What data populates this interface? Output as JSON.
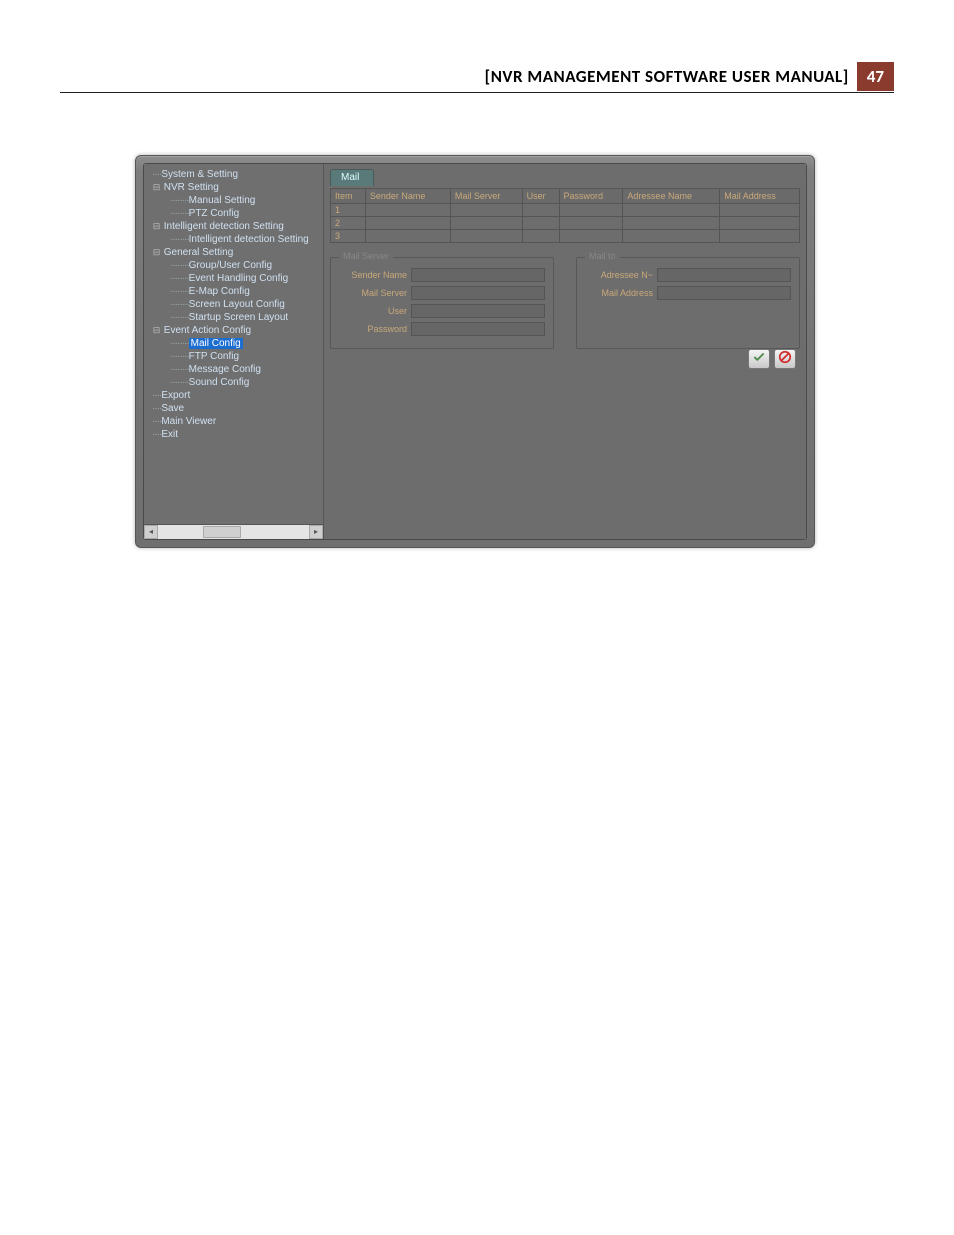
{
  "header": {
    "title": "[NVR MANAGEMENT SOFTWARE USER MANUAL]",
    "page_number": "47"
  },
  "tree": {
    "items": [
      {
        "label": "System & Setting",
        "indent": 0,
        "expand": "",
        "selected": false
      },
      {
        "label": "NVR  Setting",
        "indent": 0,
        "expand": "⊟",
        "selected": false
      },
      {
        "label": "Manual Setting",
        "indent": 1,
        "expand": "",
        "selected": false
      },
      {
        "label": "PTZ Config",
        "indent": 1,
        "expand": "",
        "selected": false
      },
      {
        "label": "Intelligent detection Setting",
        "indent": 0,
        "expand": "⊟",
        "selected": false
      },
      {
        "label": "Intelligent detection Setting",
        "indent": 1,
        "expand": "",
        "selected": false
      },
      {
        "label": "General Setting",
        "indent": 0,
        "expand": "⊟",
        "selected": false
      },
      {
        "label": "Group/User Config",
        "indent": 1,
        "expand": "",
        "selected": false
      },
      {
        "label": "Event Handling Config",
        "indent": 1,
        "expand": "",
        "selected": false
      },
      {
        "label": "E-Map Config",
        "indent": 1,
        "expand": "",
        "selected": false
      },
      {
        "label": "Screen Layout Config",
        "indent": 1,
        "expand": "",
        "selected": false
      },
      {
        "label": "Startup Screen Layout",
        "indent": 1,
        "expand": "",
        "selected": false
      },
      {
        "label": "Event Action Config",
        "indent": 0,
        "expand": "⊟",
        "selected": false
      },
      {
        "label": "Mail Config",
        "indent": 1,
        "expand": "",
        "selected": true
      },
      {
        "label": "FTP Config",
        "indent": 1,
        "expand": "",
        "selected": false
      },
      {
        "label": "Message Config",
        "indent": 1,
        "expand": "",
        "selected": false
      },
      {
        "label": "Sound Config",
        "indent": 1,
        "expand": "",
        "selected": false
      },
      {
        "label": "Export",
        "indent": 0,
        "expand": "",
        "selected": false
      },
      {
        "label": "Save",
        "indent": 0,
        "expand": "",
        "selected": false
      },
      {
        "label": "Main Viewer",
        "indent": 0,
        "expand": "",
        "selected": false
      },
      {
        "label": "Exit",
        "indent": 0,
        "expand": "",
        "selected": false
      }
    ]
  },
  "panel": {
    "tab_label": "Mail",
    "table": {
      "headers": [
        "Item",
        "Sender Name",
        "Mail Server",
        "User",
        "Password",
        "Adressee Name",
        "Mail Address"
      ],
      "rows": [
        {
          "item": "1",
          "sender_name": "",
          "mail_server": "",
          "user": "",
          "password": "",
          "adressee_name": "",
          "mail_address": ""
        },
        {
          "item": "2",
          "sender_name": "",
          "mail_server": "",
          "user": "",
          "password": "",
          "adressee_name": "",
          "mail_address": ""
        },
        {
          "item": "3",
          "sender_name": "",
          "mail_server": "",
          "user": "",
          "password": "",
          "adressee_name": "",
          "mail_address": ""
        }
      ]
    },
    "mail_server": {
      "legend": "Mail Server",
      "fields": {
        "sender_name": {
          "label": "Sender Name",
          "value": ""
        },
        "mail_server": {
          "label": "Mail Server",
          "value": ""
        },
        "user": {
          "label": "User",
          "value": ""
        },
        "password": {
          "label": "Password",
          "value": ""
        }
      }
    },
    "mail_to": {
      "legend": "Mail to",
      "fields": {
        "adressee_name": {
          "label": "Adressee N~",
          "value": ""
        },
        "mail_address": {
          "label": "Mail Address",
          "value": ""
        }
      }
    },
    "buttons": {
      "apply_icon": "check-icon",
      "cancel_icon": "cancel-icon"
    }
  }
}
